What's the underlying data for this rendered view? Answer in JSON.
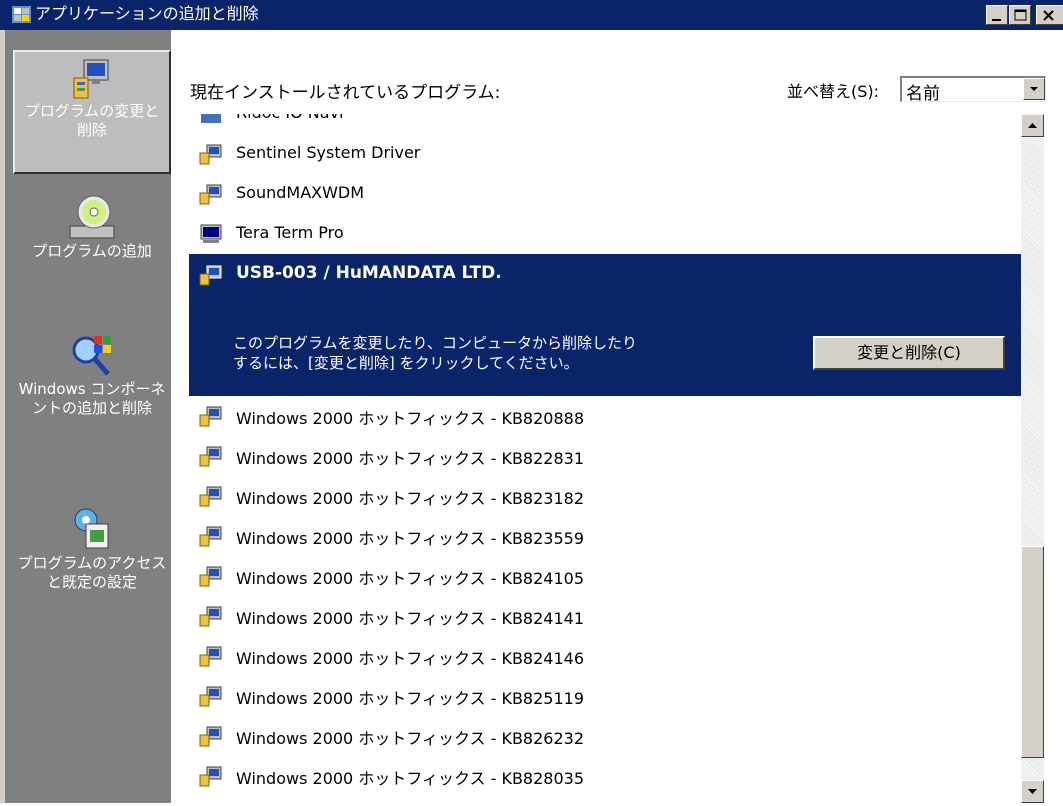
{
  "window": {
    "title": "アプリケーションの追加と削除",
    "controls": [
      "minimize",
      "maximize",
      "close"
    ]
  },
  "sidebar": {
    "items": [
      {
        "label": "プログラムの変更と削除",
        "icon": "change-remove-programs-icon",
        "active": true
      },
      {
        "label": "プログラムの追加",
        "icon": "add-programs-cd-icon",
        "active": false
      },
      {
        "label": "Windows コンポーネントの追加と削除",
        "icon": "windows-components-icon",
        "active": false
      },
      {
        "label": "プログラムのアクセスと既定の設定",
        "icon": "program-access-defaults-icon",
        "active": false
      }
    ]
  },
  "main": {
    "heading": "現在インストールされているプログラム:",
    "sort_label": "並べ替え(S):",
    "sort_value": "名前",
    "programs": [
      {
        "name": "Ridoc IO Navi",
        "icon": "ridoc-icon"
      },
      {
        "name": "Sentinel System Driver",
        "icon": "program-icon"
      },
      {
        "name": "SoundMAXWDM",
        "icon": "program-icon"
      },
      {
        "name": "Tera Term Pro",
        "icon": "terminal-icon"
      },
      {
        "name": "Windows 2000 ホットフィックス - KB820888",
        "icon": "program-icon"
      },
      {
        "name": "Windows 2000 ホットフィックス - KB822831",
        "icon": "program-icon"
      },
      {
        "name": "Windows 2000 ホットフィックス - KB823182",
        "icon": "program-icon"
      },
      {
        "name": "Windows 2000 ホットフィックス - KB823559",
        "icon": "program-icon"
      },
      {
        "name": "Windows 2000 ホットフィックス - KB824105",
        "icon": "program-icon"
      },
      {
        "name": "Windows 2000 ホットフィックス - KB824141",
        "icon": "program-icon"
      },
      {
        "name": "Windows 2000 ホットフィックス - KB824146",
        "icon": "program-icon"
      },
      {
        "name": "Windows 2000 ホットフィックス - KB825119",
        "icon": "program-icon"
      },
      {
        "name": "Windows 2000 ホットフィックス - KB826232",
        "icon": "program-icon"
      },
      {
        "name": "Windows 2000 ホットフィックス - KB828035",
        "icon": "program-icon"
      }
    ],
    "selected": {
      "name": "USB-003 / HuMANDATA LTD.",
      "desc_line1": "このプログラムを変更したり、コンピュータから削除したり",
      "desc_line2": "するには、[変更と削除] をクリックしてください。",
      "button_label": "変更と削除(C)"
    }
  },
  "colors": {
    "title_bar": "#0a246a",
    "selection": "#0a246a",
    "sidebar": "#808080",
    "face": "#d4d0c8"
  }
}
